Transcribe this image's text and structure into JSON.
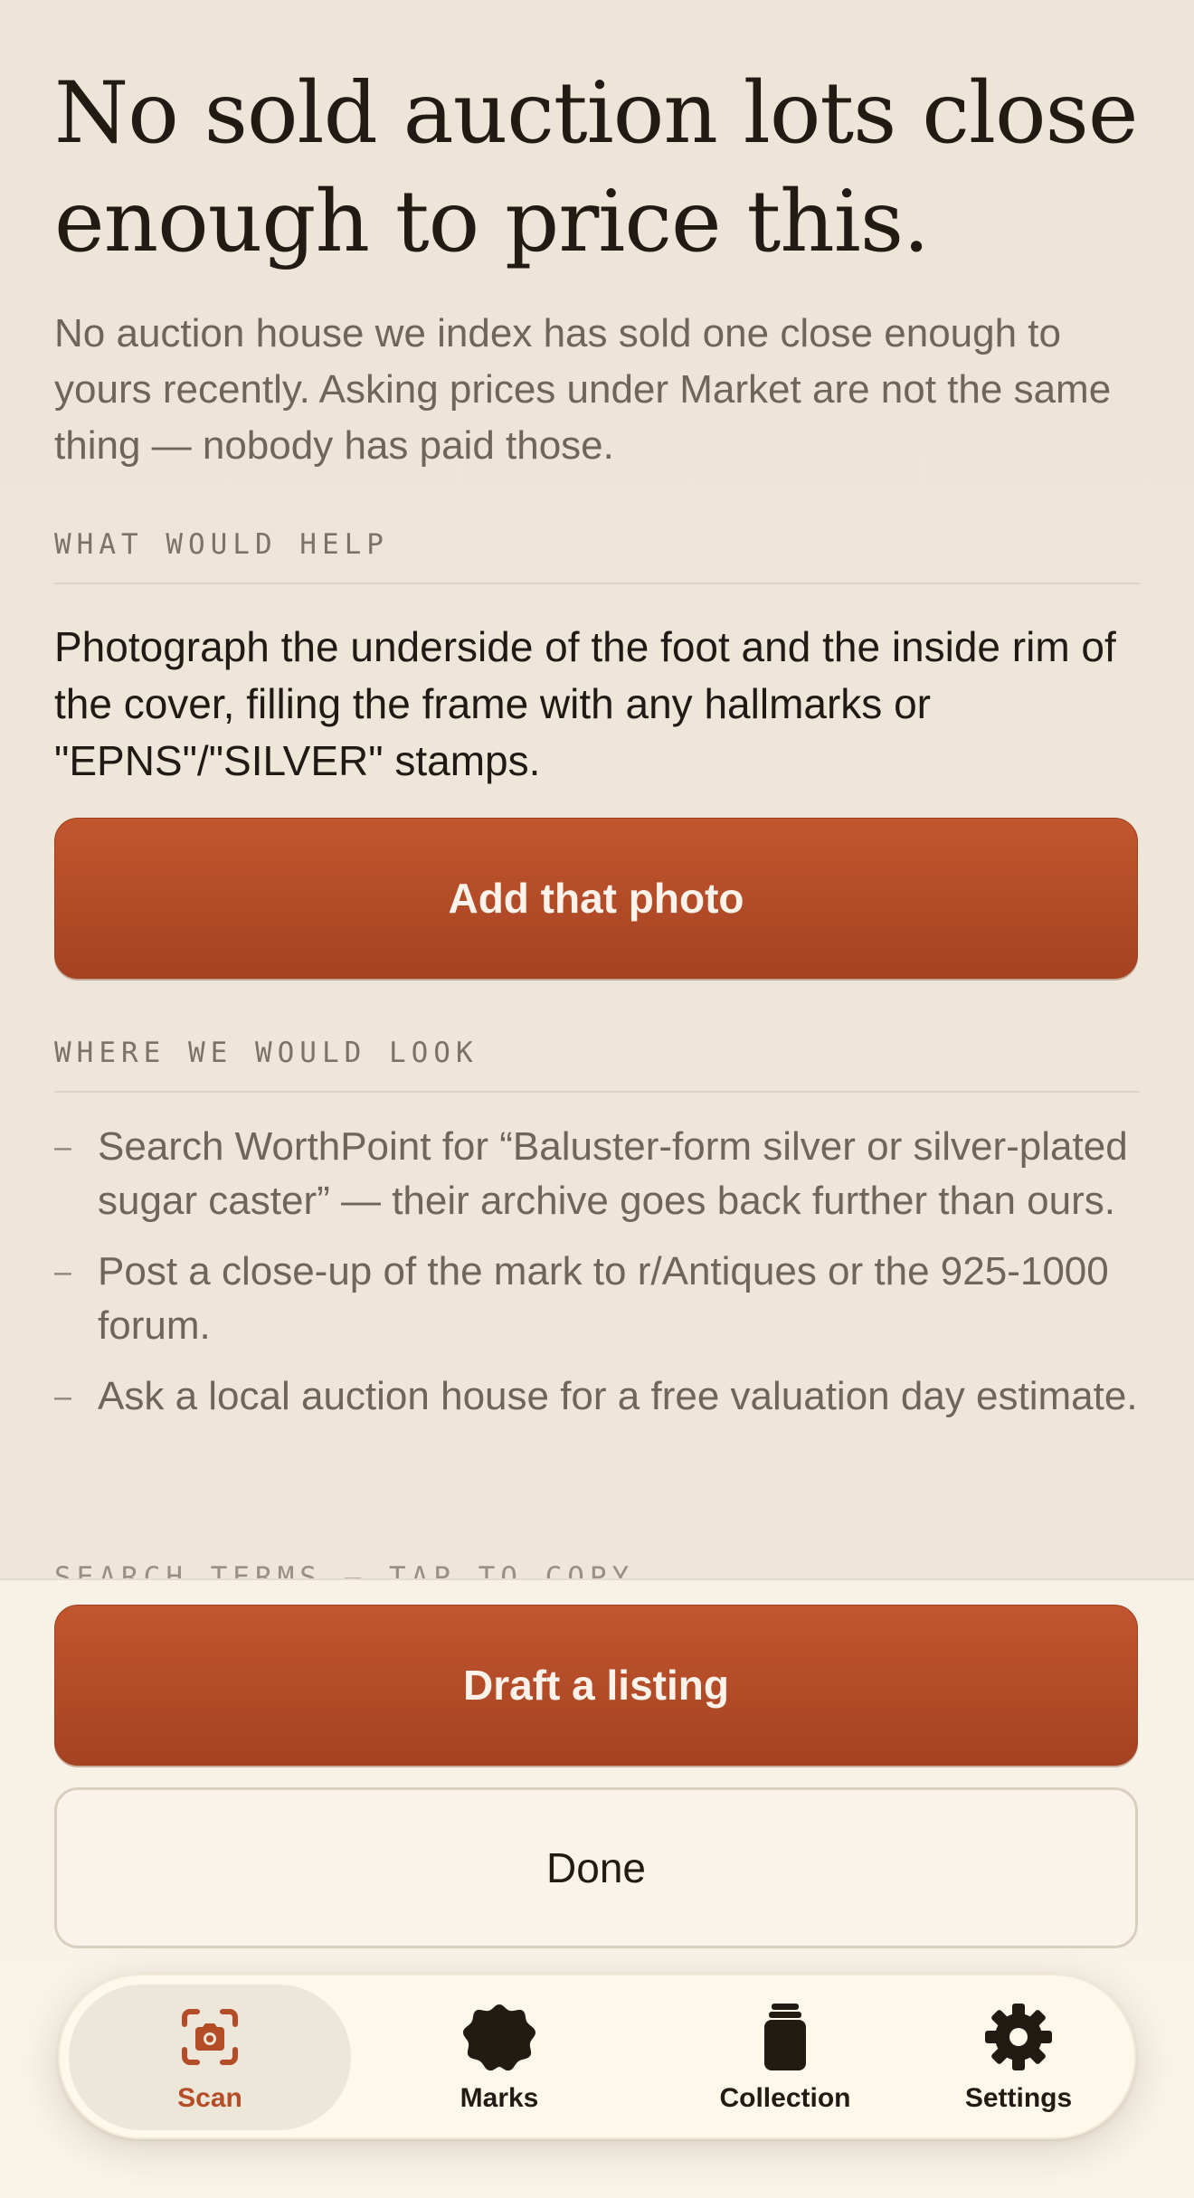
{
  "headline": "No sold auction lots close enough to price this.",
  "lede": "No auction house we index has sold one close enough to yours recently. Asking prices under Market are not the same thing — nobody has paid those.",
  "help": {
    "label": "WHAT WOULD HELP",
    "text": "Photograph the underside of the foot and the inside rim of the cover, filling the frame with any hallmarks or \"EPNS\"/\"SILVER\" stamps.",
    "button": "Add that photo"
  },
  "look": {
    "label": "WHERE WE WOULD LOOK",
    "dash": "–",
    "items": [
      "Search WorthPoint for “Baluster-form silver or silver-plated sugar caster” — their archive goes back further than ours.",
      "Post a close-up of the mark to r/Antiques or the 925-1000 forum.",
      "Ask a local auction house for a free valuation day estimate."
    ]
  },
  "search_terms": {
    "label": "SEARCH TERMS — TAP TO COPY"
  },
  "actions": {
    "draft": "Draft a listing",
    "done": "Done"
  },
  "tabs": [
    {
      "label": "Scan",
      "icon": "camera-icon",
      "active": true
    },
    {
      "label": "Marks",
      "icon": "seal-icon",
      "active": false
    },
    {
      "label": "Collection",
      "icon": "jar-icon",
      "active": false
    },
    {
      "label": "Settings",
      "icon": "gear-icon",
      "active": false
    }
  ],
  "colors": {
    "accent": "#b44c27",
    "background": "#ede5d7",
    "panel": "#f8f1e6",
    "text": "#221b13",
    "muted": "#6f655a"
  }
}
